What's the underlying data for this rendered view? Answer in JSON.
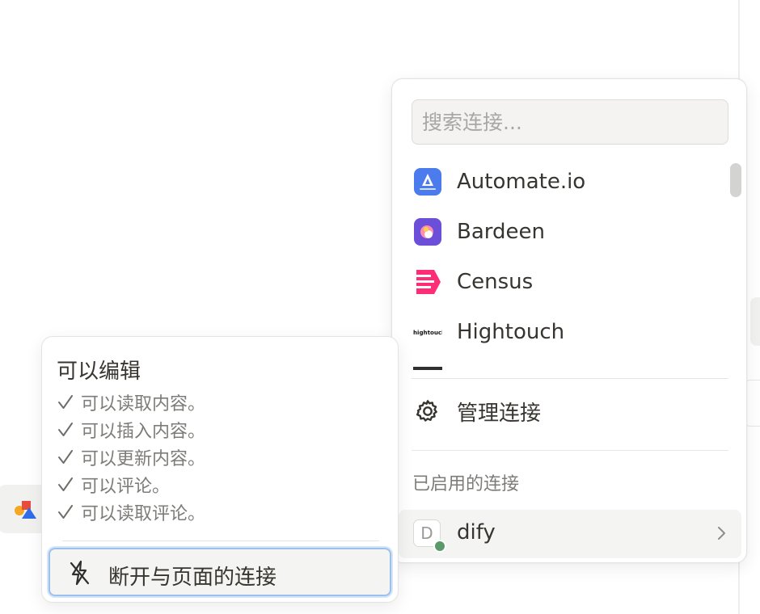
{
  "connections_menu": {
    "search": {
      "placeholder": "搜索连接...",
      "value": ""
    },
    "items": [
      {
        "label": "Automate.io",
        "icon": "automateio-logo-icon"
      },
      {
        "label": "Bardeen",
        "icon": "bardeen-logo-icon"
      },
      {
        "label": "Census",
        "icon": "census-logo-icon"
      },
      {
        "label": "Hightouch",
        "icon": "hightouch-logo-icon",
        "icon_text": "hightouch"
      }
    ],
    "manage": {
      "label": "管理连接",
      "icon": "gear-icon"
    },
    "enabled_section": {
      "title": "已启用的连接",
      "items": [
        {
          "label": "dify",
          "avatar_letter": "D",
          "status": "connected",
          "status_color": "#5a9a6a"
        }
      ]
    }
  },
  "permissions_menu": {
    "title": "可以编辑",
    "permissions": [
      "可以读取内容。",
      "可以插入内容。",
      "可以更新内容。",
      "可以评论。",
      "可以读取评论。"
    ],
    "disconnect_label": "断开与页面的连接"
  },
  "colors": {
    "automateio": "#4b7bec",
    "bardeen": "#6b4fd8",
    "census": "#ff2d78",
    "focus_ring": "#9cc0ec",
    "hover_bg": "#f4f4f2"
  }
}
